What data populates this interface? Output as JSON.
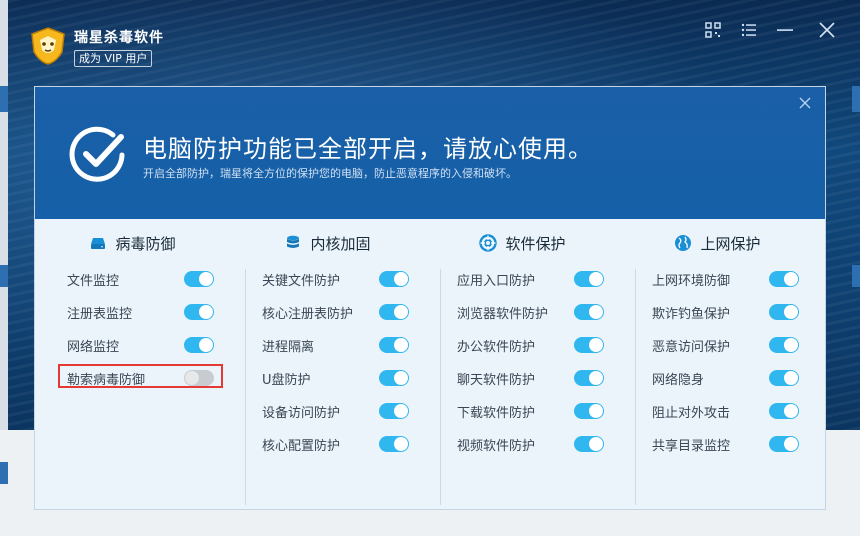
{
  "app": {
    "title": "瑞星杀毒软件",
    "vip_label": "成为 VIP 用户"
  },
  "titlebar_icons": [
    "qr-code-icon",
    "menu-icon",
    "minimize-icon",
    "close-icon"
  ],
  "dialog": {
    "title": "电脑防护功能已全部开启，请放心使用。",
    "subtitle": "开启全部防护，瑞星将全方位的保护您的电脑，防止恶意程序的入侵和破坏。"
  },
  "sections": [
    {
      "name": "病毒防御",
      "icon": "disk-icon",
      "items": [
        {
          "label": "文件监控",
          "on": true
        },
        {
          "label": "注册表监控",
          "on": true
        },
        {
          "label": "网络监控",
          "on": true
        },
        {
          "label": "勒索病毒防御",
          "on": false,
          "highlighted": true
        }
      ]
    },
    {
      "name": "内核加固",
      "icon": "database-icon",
      "items": [
        {
          "label": "关键文件防护",
          "on": true
        },
        {
          "label": "核心注册表防护",
          "on": true
        },
        {
          "label": "进程隔离",
          "on": true
        },
        {
          "label": "U盘防护",
          "on": true
        },
        {
          "label": "设备访问防护",
          "on": true
        },
        {
          "label": "核心配置防护",
          "on": true
        }
      ]
    },
    {
      "name": "软件保护",
      "icon": "lifebuoy-icon",
      "items": [
        {
          "label": "应用入口防护",
          "on": true
        },
        {
          "label": "浏览器软件防护",
          "on": true
        },
        {
          "label": "办公软件防护",
          "on": true
        },
        {
          "label": "聊天软件防护",
          "on": true
        },
        {
          "label": "下载软件防护",
          "on": true
        },
        {
          "label": "视频软件防护",
          "on": true
        }
      ]
    },
    {
      "name": "上网保护",
      "icon": "globe-icon",
      "items": [
        {
          "label": "上网环境防御",
          "on": true
        },
        {
          "label": "欺诈钓鱼保护",
          "on": true
        },
        {
          "label": "恶意访问保护",
          "on": true
        },
        {
          "label": "网络隐身",
          "on": true
        },
        {
          "label": "阻止对外攻击",
          "on": true
        },
        {
          "label": "共享目录监控",
          "on": true
        }
      ]
    }
  ],
  "colors": {
    "toggle_on": "#31b7ef",
    "toggle_off": "#c8ccd0",
    "header": "#1560a8",
    "highlight_border": "#e53935"
  }
}
